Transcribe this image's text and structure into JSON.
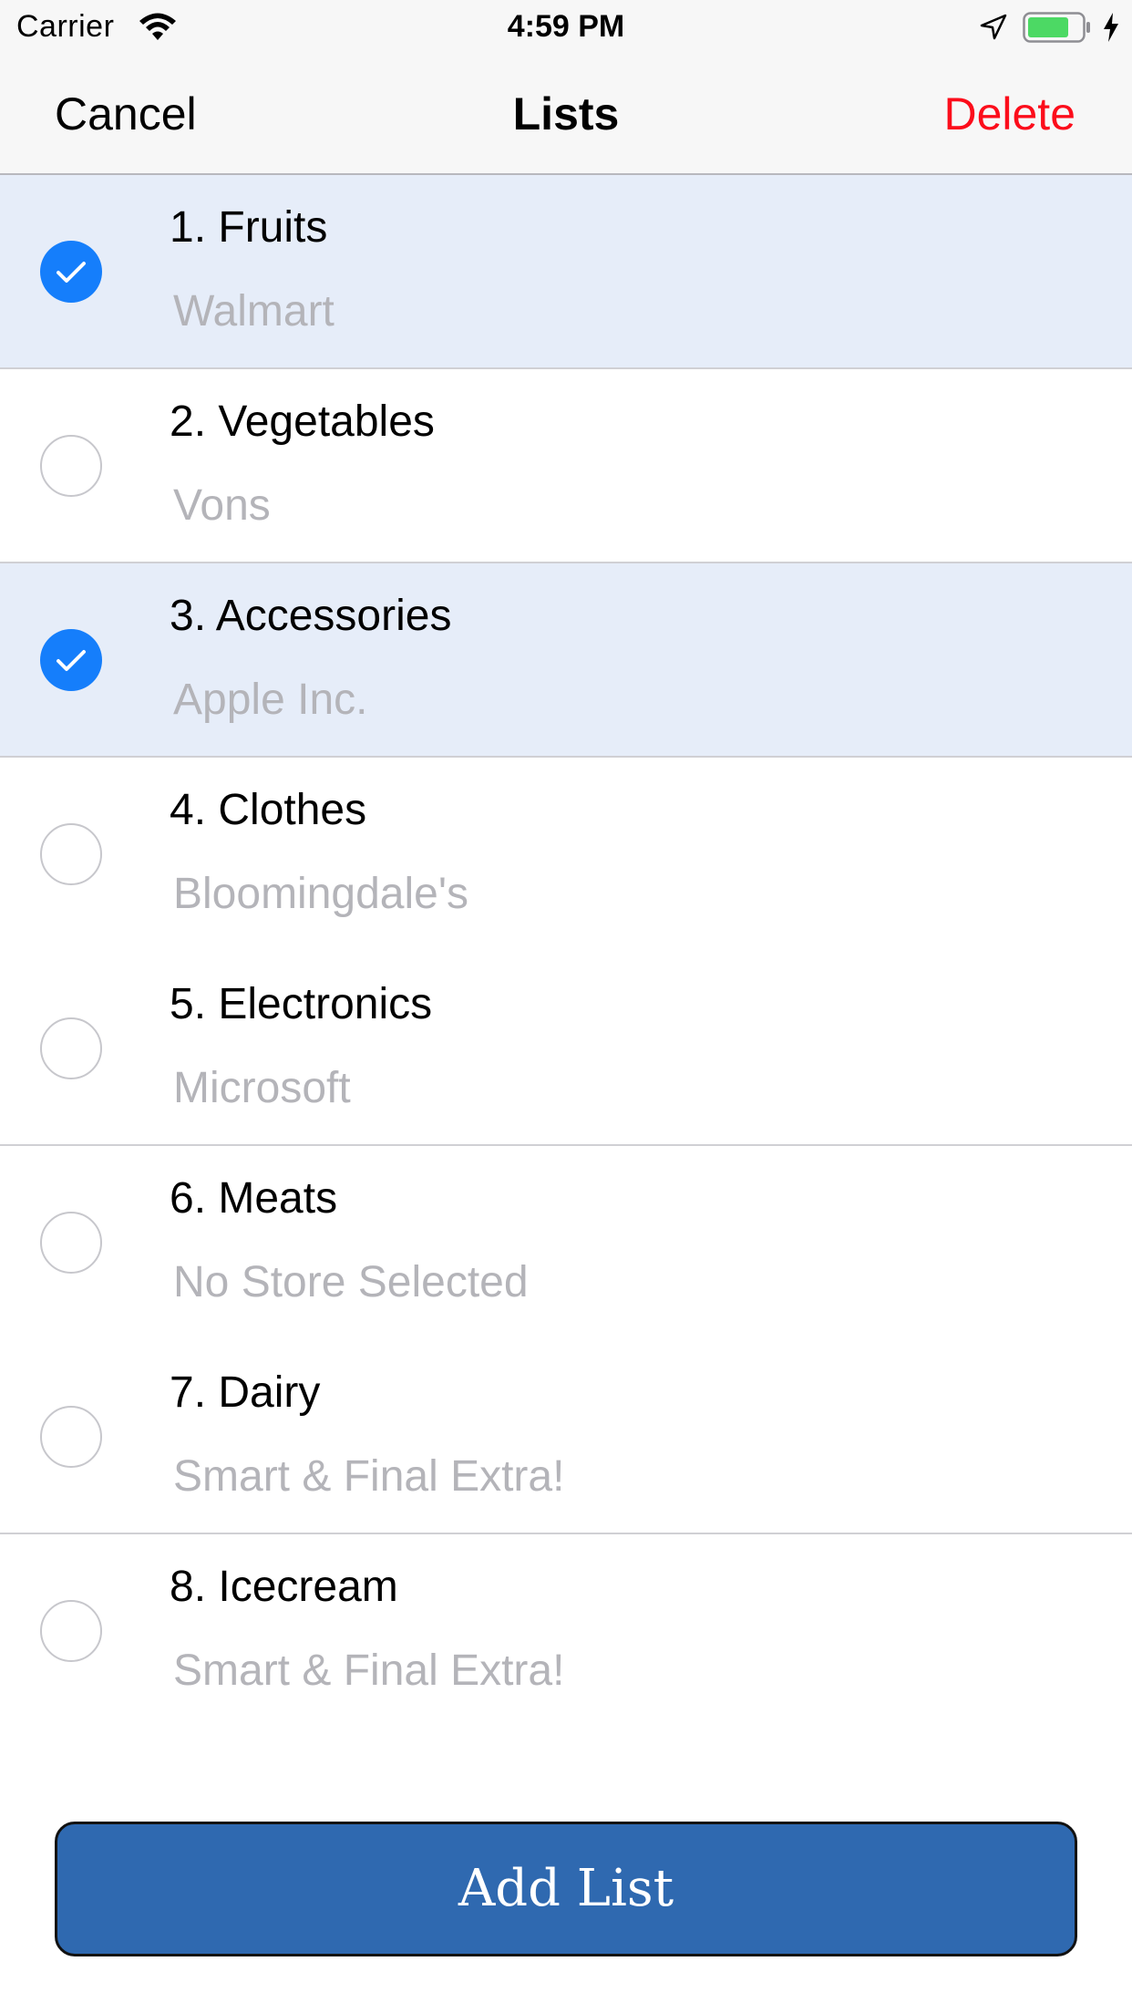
{
  "status_bar": {
    "carrier": "Carrier",
    "time": "4:59 PM",
    "battery_color": "#4cd964",
    "icons": [
      "wifi-icon",
      "location-icon",
      "battery-icon",
      "charging-icon"
    ]
  },
  "nav": {
    "cancel_label": "Cancel",
    "title": "Lists",
    "delete_label": "Delete",
    "delete_color": "#fc0d1b"
  },
  "lists": [
    {
      "title": "1. Fruits",
      "store": "Walmart",
      "selected": true
    },
    {
      "title": "2. Vegetables",
      "store": "Vons",
      "selected": false
    },
    {
      "title": "3. Accessories",
      "store": "Apple Inc.",
      "selected": true
    },
    {
      "title": "4. Clothes",
      "store": "Bloomingdale's",
      "selected": false
    },
    {
      "title": "5. Electronics",
      "store": "Microsoft",
      "selected": false
    },
    {
      "title": "6. Meats",
      "store": "No Store Selected",
      "selected": false
    },
    {
      "title": "7. Dairy",
      "store": "Smart & Final Extra!",
      "selected": false
    },
    {
      "title": "8. Icecream",
      "store": "Smart & Final Extra!",
      "selected": false
    }
  ],
  "colors": {
    "selected_row": "#e6edf9",
    "checkmark_fill": "#157efb",
    "subtitle_text": "#b4b4b9",
    "add_button": "#2f69b0"
  },
  "add_button_label": "Add List"
}
